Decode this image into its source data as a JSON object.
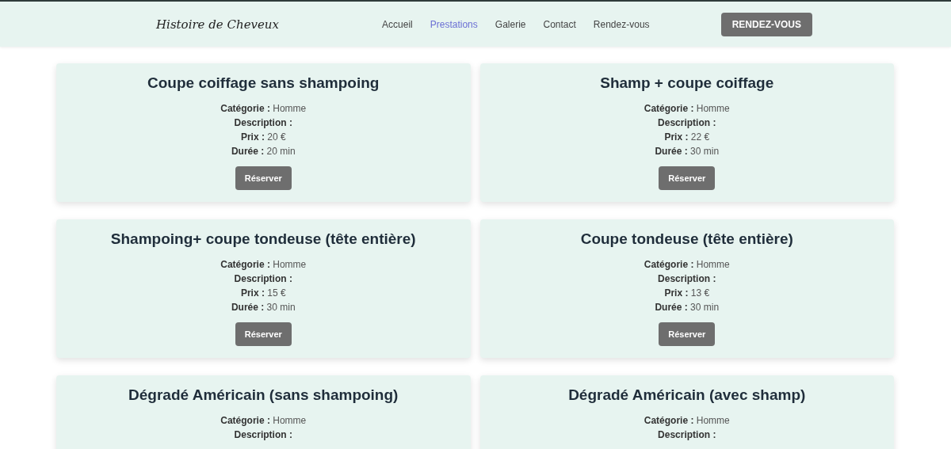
{
  "header": {
    "logo": "Histoire de Cheveux",
    "nav": [
      {
        "label": "Accueil",
        "selected": false
      },
      {
        "label": "Prestations",
        "selected": true
      },
      {
        "label": "Galerie",
        "selected": false
      },
      {
        "label": "Contact",
        "selected": false
      },
      {
        "label": "Rendez-vous",
        "selected": false
      }
    ],
    "cta": "RENDEZ-VOUS"
  },
  "services": [
    {
      "title": "Coupe coiffage sans shampoing",
      "fields": [
        "**Catégorie :** Homme",
        "**Description :**",
        "**Prix :** 20 €",
        "**Durée :** 20 min"
      ],
      "button": "Réserver"
    },
    {
      "title": "Shamp + coupe coiffage",
      "fields": [
        "**Catégorie :** Homme",
        "**Description :**",
        "**Prix :** 22 €",
        "**Durée :** 30 min"
      ],
      "button": "Réserver"
    },
    {
      "title": "Shampoing+ coupe tondeuse (tête entière)",
      "fields": [
        "**Catégorie :** Homme",
        "**Description :**",
        "**Prix :** 15 €",
        "**Durée :** 30 min"
      ],
      "button": "Réserver"
    },
    {
      "title": "Coupe tondeuse (tête entière)",
      "fields": [
        "**Catégorie :** Homme",
        "**Description :**",
        "**Prix :** 13 €",
        "**Durée :** 30 min"
      ],
      "button": "Réserver"
    },
    {
      "title": "Dégradé Américain (sans shampoing)",
      "fields": [
        "**Catégorie :** Homme",
        "**Description :**"
      ]
    },
    {
      "title": "Dégradé Américain (avec shamp)",
      "fields": [
        "**Catégorie :** Homme",
        "**Description :**"
      ]
    }
  ]
}
